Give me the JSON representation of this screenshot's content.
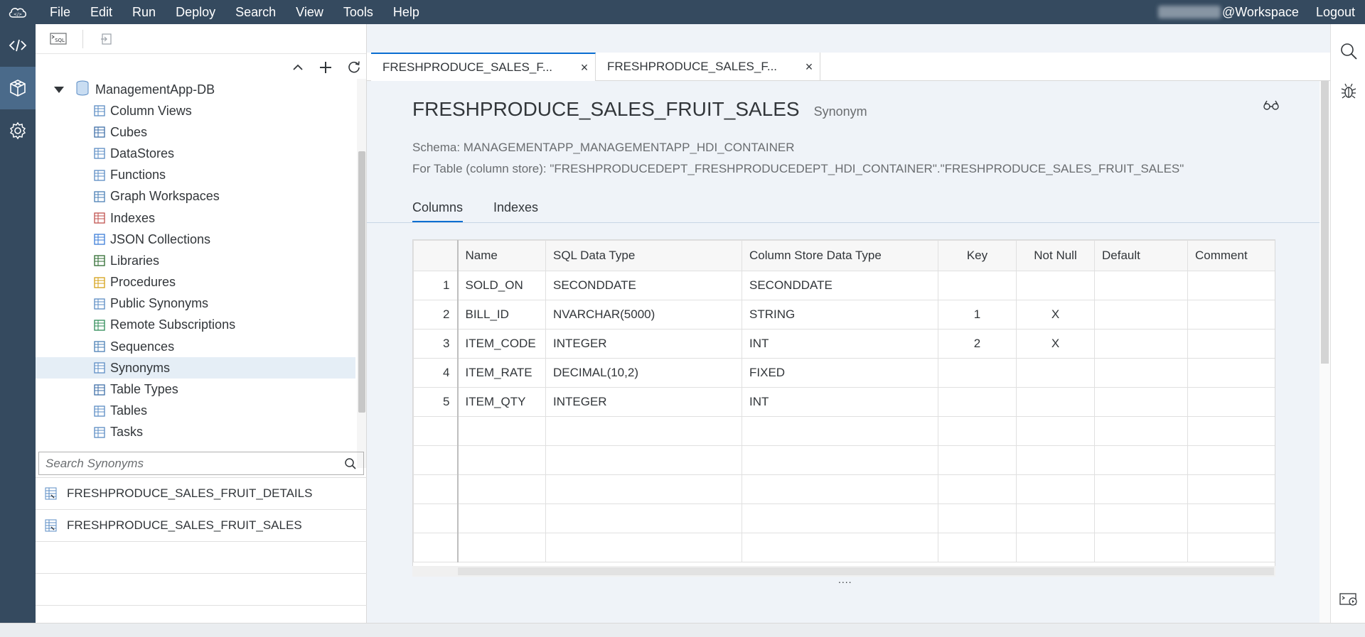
{
  "menubar": {
    "items": [
      "File",
      "Edit",
      "Run",
      "Deploy",
      "Search",
      "View",
      "Tools",
      "Help"
    ],
    "user_suffix": "@Workspace",
    "logout": "Logout"
  },
  "explorer": {
    "root": "ManagementApp-DB",
    "tree_items": [
      {
        "label": "Column Views",
        "icon": "column-views-icon"
      },
      {
        "label": "Cubes",
        "icon": "cubes-icon"
      },
      {
        "label": "DataStores",
        "icon": "datastores-icon"
      },
      {
        "label": "Functions",
        "icon": "functions-icon"
      },
      {
        "label": "Graph Workspaces",
        "icon": "graph-workspaces-icon"
      },
      {
        "label": "Indexes",
        "icon": "indexes-icon"
      },
      {
        "label": "JSON Collections",
        "icon": "json-collections-icon"
      },
      {
        "label": "Libraries",
        "icon": "libraries-icon"
      },
      {
        "label": "Procedures",
        "icon": "procedures-icon"
      },
      {
        "label": "Public Synonyms",
        "icon": "public-synonyms-icon"
      },
      {
        "label": "Remote Subscriptions",
        "icon": "remote-subscriptions-icon"
      },
      {
        "label": "Sequences",
        "icon": "sequences-icon"
      },
      {
        "label": "Synonyms",
        "icon": "synonyms-icon"
      },
      {
        "label": "Table Types",
        "icon": "table-types-icon"
      },
      {
        "label": "Tables",
        "icon": "tables-icon"
      },
      {
        "label": "Tasks",
        "icon": "tasks-icon"
      }
    ],
    "selected": "Synonyms",
    "search_placeholder": "Search Synonyms",
    "results": [
      "FRESHPRODUCE_SALES_FRUIT_DETAILS",
      "FRESHPRODUCE_SALES_FRUIT_SALES"
    ]
  },
  "tabs": [
    {
      "label": "FRESHPRODUCE_SALES_F...",
      "active": true
    },
    {
      "label": "FRESHPRODUCE_SALES_F...",
      "active": false
    }
  ],
  "detail": {
    "title": "FRESHPRODUCE_SALES_FRUIT_SALES",
    "type": "Synonym",
    "schema": "Schema: MANAGEMENTAPP_MANAGEMENTAPP_HDI_CONTAINER",
    "for_table": "For Table (column store): \"FRESHPRODUCEDEPT_FRESHPRODUCEDEPT_HDI_CONTAINER\".\"FRESHPRODUCE_SALES_FRUIT_SALES\"",
    "subtabs": [
      "Columns",
      "Indexes"
    ]
  },
  "columns_table": {
    "headers": [
      "",
      "Name",
      "SQL Data Type",
      "Column Store Data Type",
      "Key",
      "Not Null",
      "Default",
      "Comment"
    ],
    "rows": [
      [
        "1",
        "SOLD_ON",
        "SECONDDATE",
        "SECONDDATE",
        "",
        "",
        "",
        ""
      ],
      [
        "2",
        "BILL_ID",
        "NVARCHAR(5000)",
        "STRING",
        "1",
        "X",
        "",
        ""
      ],
      [
        "3",
        "ITEM_CODE",
        "INTEGER",
        "INT",
        "2",
        "X",
        "",
        ""
      ],
      [
        "4",
        "ITEM_RATE",
        "DECIMAL(10,2)",
        "FIXED",
        "",
        "",
        "",
        ""
      ],
      [
        "5",
        "ITEM_QTY",
        "INTEGER",
        "INT",
        "",
        "",
        "",
        ""
      ]
    ],
    "empty_rows": 5,
    "splitter": "...."
  },
  "colors": {
    "shell": "#354a5f",
    "accent": "#0a6ed1",
    "content_bg": "#eff3f8"
  }
}
